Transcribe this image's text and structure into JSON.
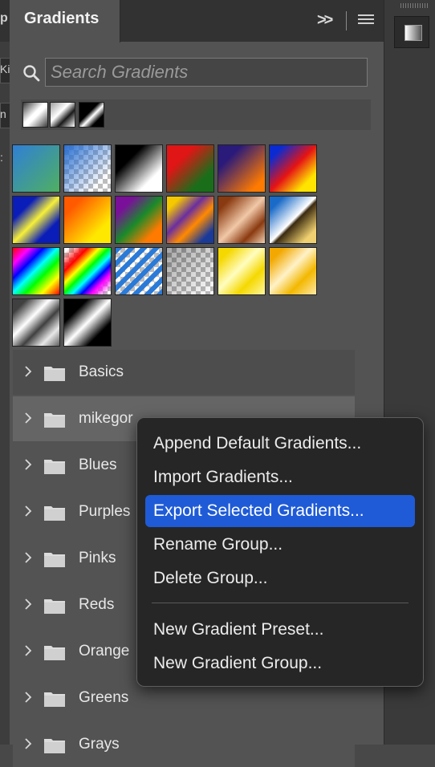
{
  "left_strip": {
    "chars": [
      "p",
      "Ki",
      "n",
      ":"
    ]
  },
  "panel": {
    "tab_title": "Gradients",
    "header_icons": [
      "expand-icon",
      "panel-menu-icon"
    ],
    "expand_glyph": ">>"
  },
  "search": {
    "placeholder": "Search Gradients",
    "value": ""
  },
  "recent_swatches": [
    {
      "name": "recent-gradient-1",
      "style": "linear-gradient(135deg,#3a3a3a,#ffffff 45%,#ffffff 55%,#3a3a3a)"
    },
    {
      "name": "recent-gradient-2",
      "style": "linear-gradient(135deg,#a0a0a0,#ffffff 40%,#1a1a1a 65%,#ffffff)"
    },
    {
      "name": "recent-gradient-3",
      "style": "linear-gradient(135deg,#000000,#000000 40%,#ffffff 55%,#000000 75%)"
    }
  ],
  "swatches": [
    {
      "name": "gradient-blue-green",
      "style": "linear-gradient(135deg,#2f7fd6,#4fb060)"
    },
    {
      "name": "gradient-blue-transparent",
      "style": "linear-gradient(135deg,#2a6fd0 0%,rgba(42,111,208,0) 80%)",
      "checker": true
    },
    {
      "name": "gradient-black-white",
      "style": "linear-gradient(135deg,#000 30%,#fff 75%)"
    },
    {
      "name": "gradient-red-green",
      "style": "linear-gradient(135deg,#e01515 30%,#1a6e1a 75%)"
    },
    {
      "name": "gradient-violet-orange",
      "style": "linear-gradient(135deg,#2a1a7a 25%,#ff7a00 85%)"
    },
    {
      "name": "gradient-blue-red-yellow",
      "style": "linear-gradient(135deg,#0a2bd1 15%,#e51414 50%,#ffe400 80%)"
    },
    {
      "name": "gradient-blue-yellow-blue",
      "style": "linear-gradient(135deg,#0b1db8 25%,#f7f039 50%,#0b1db8 75%)"
    },
    {
      "name": "gradient-orange-yellow",
      "style": "linear-gradient(135deg,#ff5a00 20%,#ffe800 75%)"
    },
    {
      "name": "gradient-violet-green-orange",
      "style": "linear-gradient(135deg,#7a0f9a 20%,#1a8a2a 50%,#ff7a00 80%)"
    },
    {
      "name": "gradient-yellow-violet-orange-blue",
      "style": "linear-gradient(135deg,#f5c800 15%,#6a2fa0 40%,#ff8a00 60%,#1a3a9a 85%)"
    },
    {
      "name": "gradient-copper",
      "style": "linear-gradient(135deg,#8a3a10 15%,#f0c8a8 50%,#8a3a10 75%,#f0d0b0)"
    },
    {
      "name": "gradient-chrome",
      "style": "linear-gradient(135deg,#1a6ac8 15%,#ffffff 50%,#3a2a10 55%,#f0d070 85%)"
    },
    {
      "name": "gradient-spectrum",
      "style": "linear-gradient(135deg,#ff0000,#ff00ff 18%,#0000ff 33%,#00ffff 48%,#00ff00 62%,#ffff00 80%,#ff0000)"
    },
    {
      "name": "gradient-transparent-rainbow",
      "style": "linear-gradient(135deg,rgba(255,0,0,0) 5%,#ff0000 25%,#ffff00 38%,#00ff00 48%,#00ffff 58%,#0000ff 68%,#ff00ff 78%,rgba(255,0,255,0) 95%)",
      "checker": true
    },
    {
      "name": "gradient-transparent-stripes",
      "style": "repeating-linear-gradient(135deg,#2a7ad8 0 6px,rgba(255,255,255,0) 6px 11px)",
      "checker": true
    },
    {
      "name": "gradient-neutral-density",
      "style": "linear-gradient(135deg,rgba(0,0,0,0.35),rgba(0,0,0,0))",
      "checker": true
    },
    {
      "name": "gradient-yellow-sheen",
      "style": "linear-gradient(135deg,#f5d800 15%,#fffdc0 45%,#f5d800 70%,#fff7a0)"
    },
    {
      "name": "gradient-gold-sheen",
      "style": "linear-gradient(135deg,#f2a800 15%,#fff2c8 45%,#f2b800 70%,#ffe9a8)"
    },
    {
      "name": "gradient-silver",
      "style": "linear-gradient(135deg,#404040 15%,#ffffff 40%,#404040 60%,#e8e8e8 80%,#606060)"
    },
    {
      "name": "gradient-black-silver",
      "style": "linear-gradient(135deg,#000 25%,#ffffff 50%,#000 75%)"
    }
  ],
  "groups": [
    {
      "name": "Basics"
    },
    {
      "name": "mikegor...l...",
      "label": "mikegor"
    },
    {
      "name": "Blues"
    },
    {
      "name": "Purples"
    },
    {
      "name": "Pinks"
    },
    {
      "name": "Reds"
    },
    {
      "name": "Orange"
    },
    {
      "name": "Greens"
    },
    {
      "name": "Grays"
    }
  ],
  "context_menu": {
    "items": [
      "Append Default Gradients...",
      "Import Gradients...",
      "Export Selected Gradients...",
      "Rename Group...",
      "Delete Group...",
      "New Gradient Preset...",
      "New Gradient Group..."
    ],
    "highlighted_index": 2,
    "highlight_color": "#1f5bd7"
  }
}
